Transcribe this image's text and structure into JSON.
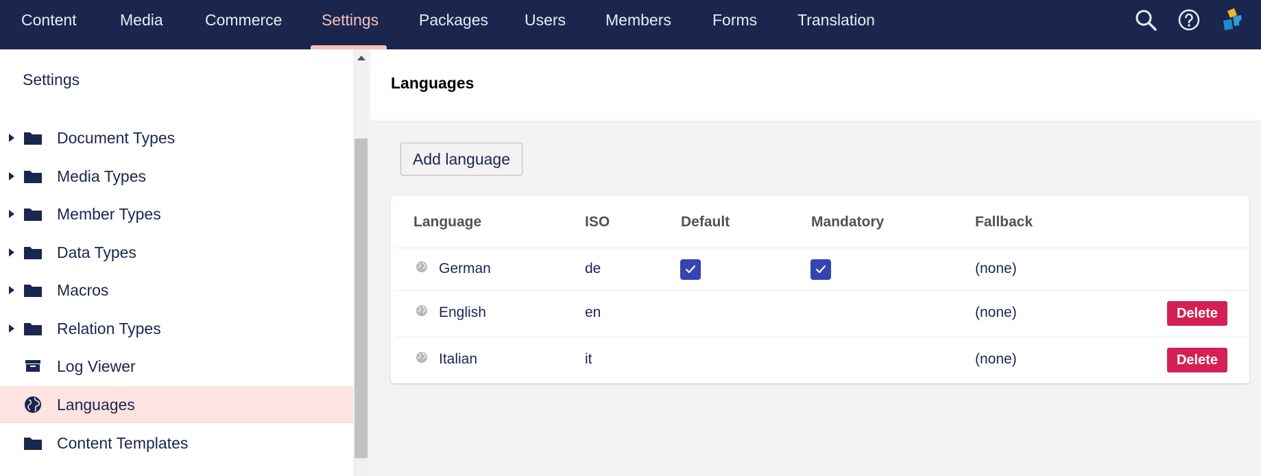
{
  "nav": {
    "items": [
      {
        "label": "Content",
        "active": false
      },
      {
        "label": "Media",
        "active": false
      },
      {
        "label": "Commerce",
        "active": false
      },
      {
        "label": "Settings",
        "active": true
      },
      {
        "label": "Packages",
        "active": false
      },
      {
        "label": "Users",
        "active": false
      },
      {
        "label": "Members",
        "active": false
      },
      {
        "label": "Forms",
        "active": false
      },
      {
        "label": "Translation",
        "active": false
      }
    ],
    "icons": [
      "search-icon",
      "help-icon",
      "user-avatar-icon"
    ]
  },
  "sidebar": {
    "title": "Settings",
    "items": [
      {
        "label": "Document Types",
        "icon": "folder-icon",
        "expandable": true
      },
      {
        "label": "Media Types",
        "icon": "folder-icon",
        "expandable": true
      },
      {
        "label": "Member Types",
        "icon": "folder-icon",
        "expandable": true
      },
      {
        "label": "Data Types",
        "icon": "folder-icon",
        "expandable": true
      },
      {
        "label": "Macros",
        "icon": "folder-icon",
        "expandable": true
      },
      {
        "label": "Relation Types",
        "icon": "folder-icon",
        "expandable": true
      },
      {
        "label": "Log Viewer",
        "icon": "archive-icon",
        "expandable": false
      },
      {
        "label": "Languages",
        "icon": "globe-icon",
        "expandable": false,
        "selected": true
      },
      {
        "label": "Content Templates",
        "icon": "folder-icon",
        "expandable": false
      }
    ]
  },
  "main": {
    "title": "Languages",
    "add_button": "Add language",
    "table": {
      "headers": [
        "Language",
        "ISO",
        "Default",
        "Mandatory",
        "Fallback"
      ],
      "rows": [
        {
          "language": "German",
          "iso": "de",
          "default": true,
          "mandatory": true,
          "fallback": "(none)",
          "delete": ""
        },
        {
          "language": "English",
          "iso": "en",
          "default": false,
          "mandatory": false,
          "fallback": "(none)",
          "delete": "Delete"
        },
        {
          "language": "Italian",
          "iso": "it",
          "default": false,
          "mandatory": false,
          "fallback": "(none)",
          "delete": "Delete"
        }
      ]
    }
  },
  "colors": {
    "nav_bg": "#1b264f",
    "accent": "#f5c1bc",
    "selected_bg": "#fde4e1",
    "checkbox": "#3544b1",
    "danger": "#d42054"
  }
}
